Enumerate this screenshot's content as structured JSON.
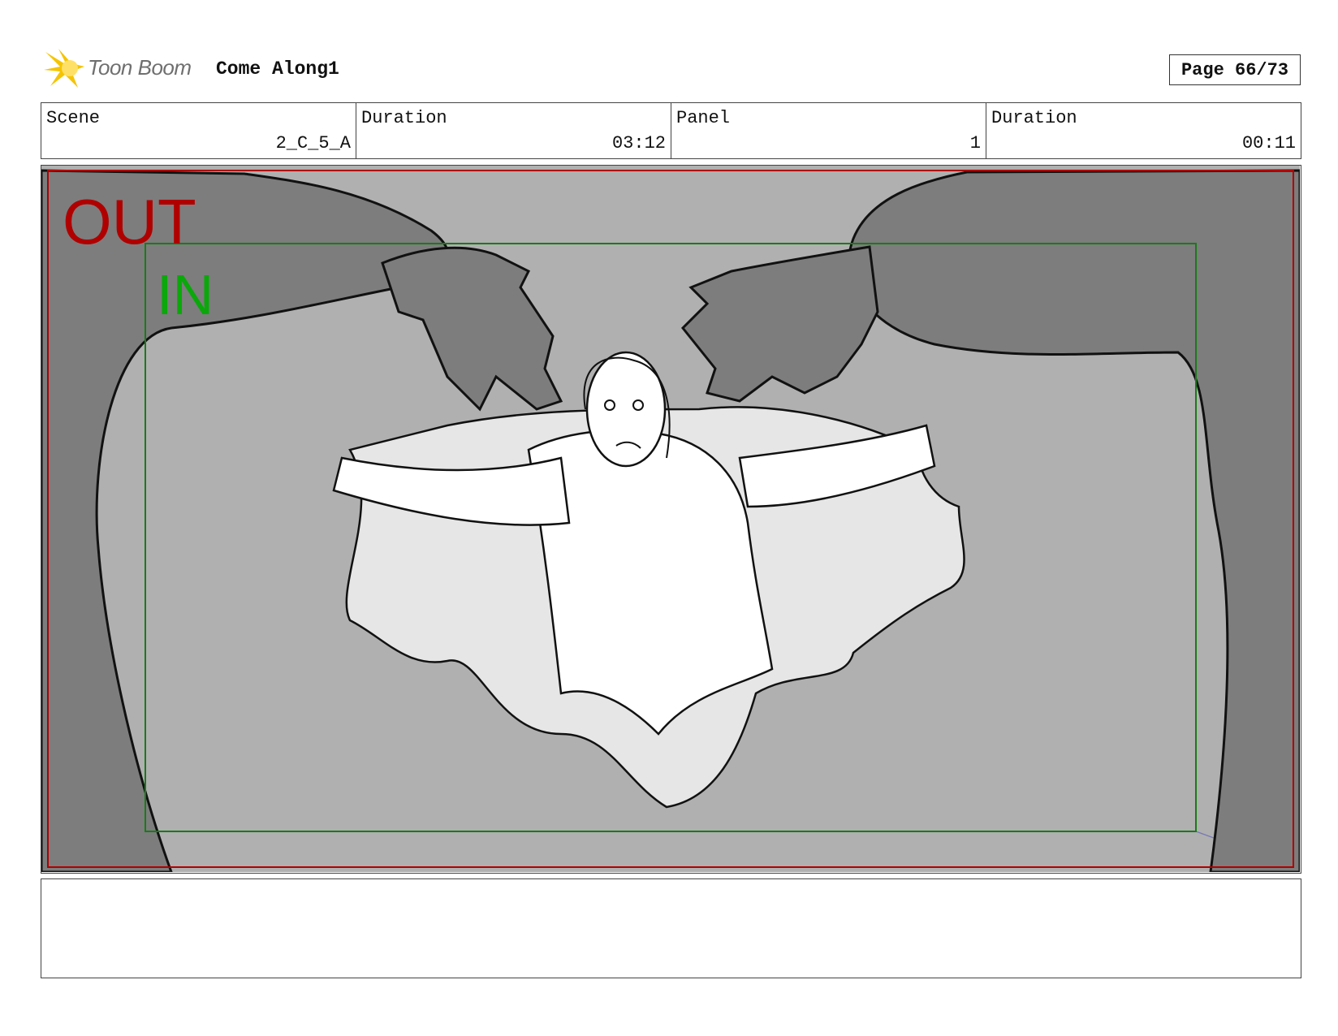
{
  "header": {
    "logo_text": "Toon Boom",
    "project_title": "Come Along1",
    "page_label": "Page 66/73"
  },
  "info": {
    "scene_label": "Scene",
    "scene_value": "2_C_5_A",
    "scene_duration_label": "Duration",
    "scene_duration_value": "03:12",
    "panel_label": "Panel",
    "panel_value": "1",
    "panel_duration_label": "Duration",
    "panel_duration_value": "00:11"
  },
  "panel": {
    "out_label": "OUT",
    "in_label": "IN"
  },
  "notes": {
    "text": ""
  },
  "colors": {
    "out_frame": "#b00000",
    "in_frame": "#1a7a1a",
    "in_label": "#0aa80a",
    "background_gray": "#b0b0b0",
    "shadow_gray": "#808080"
  }
}
